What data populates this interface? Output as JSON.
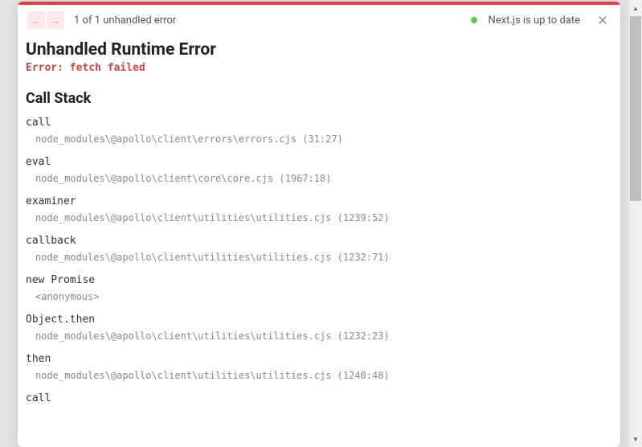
{
  "header": {
    "error_count_text": "1 of 1 unhandled error",
    "status_text": "Next.js is up to date"
  },
  "error": {
    "title": "Unhandled Runtime Error",
    "message": "Error: fetch failed"
  },
  "callstack": {
    "title": "Call Stack",
    "frames": [
      {
        "fn": "call",
        "loc": "node_modules\\@apollo\\client\\errors\\errors.cjs (31:27)"
      },
      {
        "fn": "eval",
        "loc": "node_modules\\@apollo\\client\\core\\core.cjs (1967:18)"
      },
      {
        "fn": "examiner",
        "loc": "node_modules\\@apollo\\client\\utilities\\utilities.cjs (1239:52)"
      },
      {
        "fn": "callback",
        "loc": "node_modules\\@apollo\\client\\utilities\\utilities.cjs (1232:71)"
      },
      {
        "fn": "new Promise",
        "loc": "<anonymous>"
      },
      {
        "fn": "Object.then",
        "loc": "node_modules\\@apollo\\client\\utilities\\utilities.cjs (1232:23)"
      },
      {
        "fn": "then",
        "loc": "node_modules\\@apollo\\client\\utilities\\utilities.cjs (1240:48)"
      },
      {
        "fn": "call",
        "loc": ""
      }
    ]
  }
}
